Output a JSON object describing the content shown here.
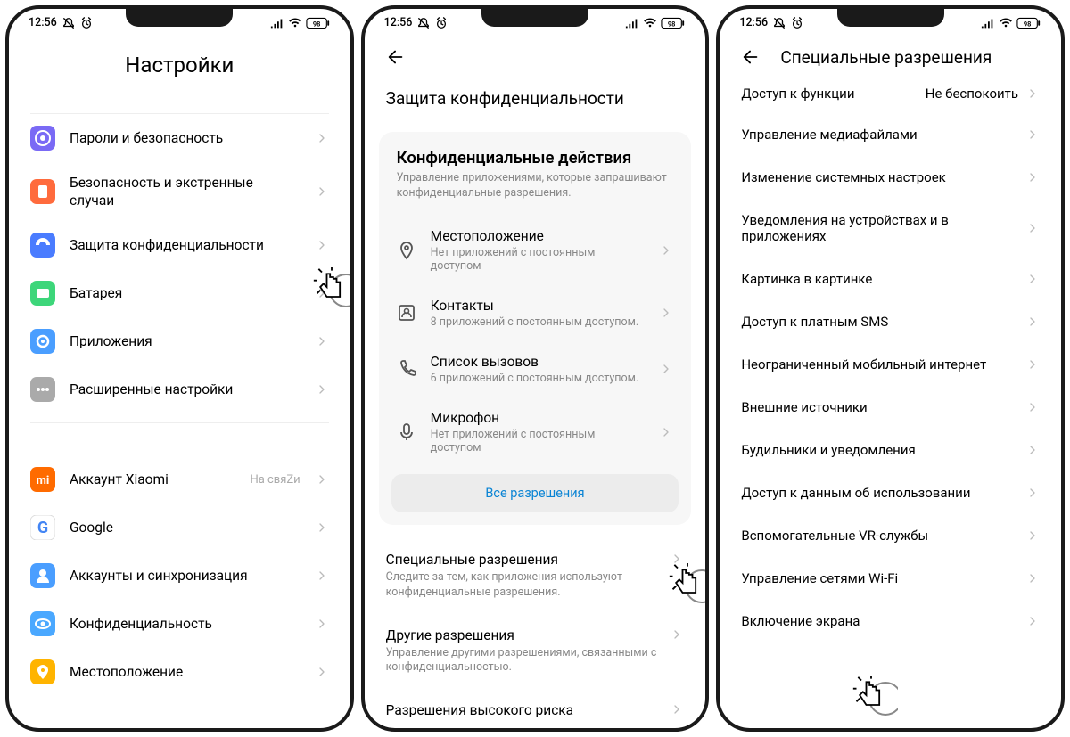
{
  "status": {
    "time": "12:56",
    "battery": "98"
  },
  "screen1": {
    "title": "Настройки",
    "group1": [
      {
        "label": "Пароли и безопасность",
        "icon": "shield",
        "bg": "#7a6af5"
      },
      {
        "label": "Безопасность и экстренные случаи",
        "icon": "warning",
        "bg": "#ff6b3d"
      },
      {
        "label": "Защита конфиденциальности",
        "icon": "privacy",
        "bg": "#4a7cff"
      },
      {
        "label": "Батарея",
        "icon": "battery",
        "bg": "#3dd67a"
      },
      {
        "label": "Приложения",
        "icon": "apps",
        "bg": "#4a9eff"
      },
      {
        "label": "Расширенные настройки",
        "icon": "more",
        "bg": "#aaaaaa"
      }
    ],
    "group2": [
      {
        "label": "Аккаунт Xiaomi",
        "trailing": "На свяZи",
        "icon": "mi",
        "bg": "#ff6b00"
      },
      {
        "label": "Google",
        "icon": "google",
        "bg": "#ffffff"
      },
      {
        "label": "Аккаунты и синхронизация",
        "icon": "account",
        "bg": "#4a9eff"
      },
      {
        "label": "Конфиденциальность",
        "icon": "eye",
        "bg": "#4aa8ff"
      },
      {
        "label": "Местоположение",
        "icon": "location",
        "bg": "#ffb400"
      }
    ]
  },
  "screen2": {
    "header": "Защита конфиденциальности",
    "card_title": "Конфиденциальные действия",
    "card_sub": "Управление приложениями, которые запрашивают конфиденциальные разрешения.",
    "perms": [
      {
        "icon": "pin",
        "label": "Местоположение",
        "sub": "Нет приложений с постоянным доступом"
      },
      {
        "icon": "contacts",
        "label": "Контакты",
        "sub": "8 приложений с постоянным доступом."
      },
      {
        "icon": "calllog",
        "label": "Список вызовов",
        "sub": "6 приложений с постоянным доступом."
      },
      {
        "icon": "mic",
        "label": "Микрофон",
        "sub": "Нет приложений с постоянным доступом"
      }
    ],
    "all": "Все разрешения",
    "sections": [
      {
        "title": "Специальные разрешения",
        "desc": "Следите за тем, как приложения используют конфиденциальные разрешения."
      },
      {
        "title": "Другие разрешения",
        "desc": "Управление другими разрешениями, связанными с конфиденциальностью."
      },
      {
        "title": "Разрешения высокого риска",
        "desc": ""
      }
    ]
  },
  "screen3": {
    "header": "Специальные разрешения",
    "items": [
      {
        "label": "Доступ к функции",
        "trailing": "Не беспокоить"
      },
      {
        "label": "Управление медиафайлами"
      },
      {
        "label": "Изменение системных настроек"
      },
      {
        "label": "Уведомления на устройствах и в приложениях"
      },
      {
        "label": "Картинка в картинке"
      },
      {
        "label": "Доступ к платным SMS"
      },
      {
        "label": "Неограниченный мобильный интернет"
      },
      {
        "label": "Внешние источники"
      },
      {
        "label": "Будильники и уведомления"
      },
      {
        "label": "Доступ к данным об использовании"
      },
      {
        "label": "Вспомогательные VR-службы"
      },
      {
        "label": "Управление сетями Wi-Fi"
      },
      {
        "label": "Включение экрана"
      }
    ]
  }
}
